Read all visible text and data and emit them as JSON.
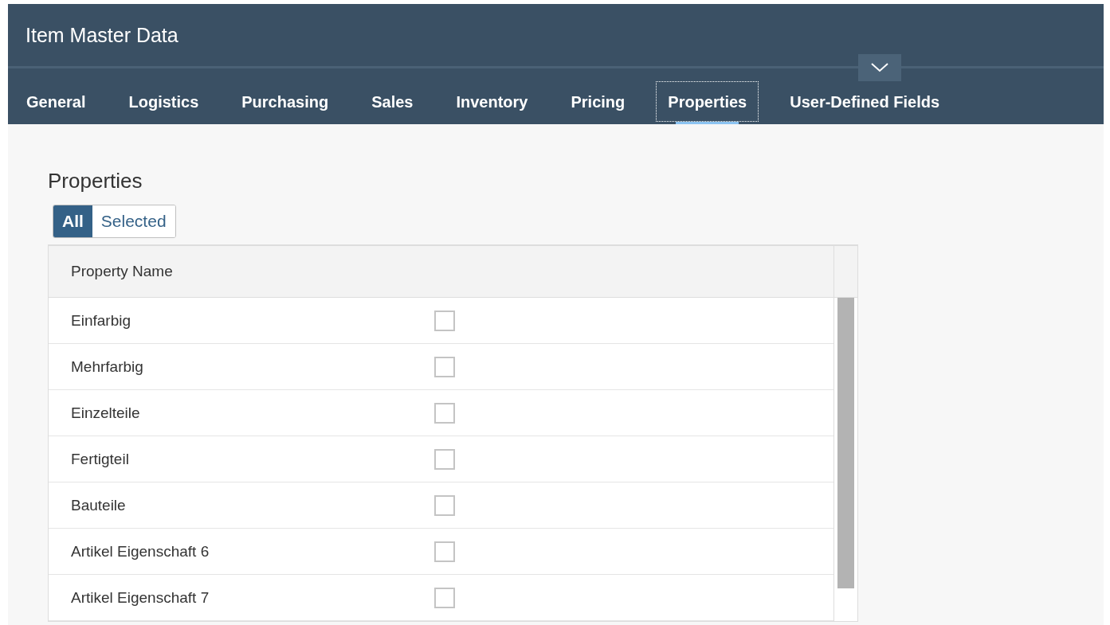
{
  "window": {
    "title": "Item Master Data"
  },
  "tabs": [
    {
      "label": "General",
      "selected": false
    },
    {
      "label": "Logistics",
      "selected": false
    },
    {
      "label": "Purchasing",
      "selected": false
    },
    {
      "label": "Sales",
      "selected": false
    },
    {
      "label": "Inventory",
      "selected": false
    },
    {
      "label": "Pricing",
      "selected": false
    },
    {
      "label": "Properties",
      "selected": true
    },
    {
      "label": "User-Defined Fields",
      "selected": false
    }
  ],
  "section": {
    "title": "Properties"
  },
  "filter": [
    {
      "label": "All",
      "selected": true
    },
    {
      "label": "Selected",
      "selected": false
    }
  ],
  "table": {
    "columns": [
      "Property Name"
    ],
    "rows": [
      {
        "name": "Einfarbig",
        "checked": false
      },
      {
        "name": "Mehrfarbig",
        "checked": false
      },
      {
        "name": "Einzelteile",
        "checked": false
      },
      {
        "name": "Fertigteil",
        "checked": false
      },
      {
        "name": "Bauteile",
        "checked": false
      },
      {
        "name": "Artikel Eigenschaft 6",
        "checked": false
      },
      {
        "name": "Artikel Eigenschaft 7",
        "checked": false
      }
    ]
  }
}
